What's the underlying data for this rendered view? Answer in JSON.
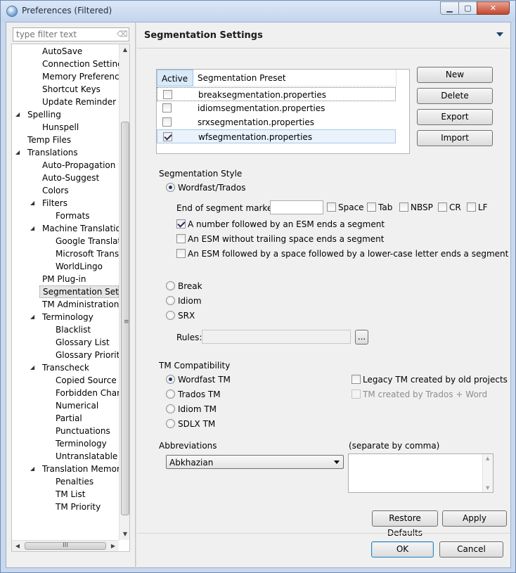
{
  "window": {
    "title": "Preferences (Filtered)",
    "controls": {
      "minimize": "▁",
      "maximize": "▢",
      "close": "✕"
    }
  },
  "filter": {
    "placeholder": "type filter text",
    "clear_icon": "⌫"
  },
  "tree": {
    "items": [
      {
        "label": "AutoSave",
        "level": 2
      },
      {
        "label": "Connection Settings",
        "level": 2
      },
      {
        "label": "Memory Preferences",
        "level": 2
      },
      {
        "label": "Shortcut Keys",
        "level": 2
      },
      {
        "label": "Update Reminder",
        "level": 2
      },
      {
        "label": "Spelling",
        "level": 1,
        "expanded": true
      },
      {
        "label": "Hunspell",
        "level": 2
      },
      {
        "label": "Temp Files",
        "level": 1
      },
      {
        "label": "Translations",
        "level": 1,
        "expanded": true
      },
      {
        "label": "Auto-Propagation",
        "level": 2
      },
      {
        "label": "Auto-Suggest",
        "level": 2
      },
      {
        "label": "Colors",
        "level": 2
      },
      {
        "label": "Filters",
        "level": 2,
        "expanded": true
      },
      {
        "label": "Formats",
        "level": 3
      },
      {
        "label": "Machine Translation",
        "level": 2,
        "expanded": true
      },
      {
        "label": "Google Translate",
        "level": 3
      },
      {
        "label": "Microsoft Translator",
        "level": 3
      },
      {
        "label": "WorldLingo",
        "level": 3
      },
      {
        "label": "PM Plug-in",
        "level": 2
      },
      {
        "label": "Segmentation Settings",
        "level": 2,
        "selected": true
      },
      {
        "label": "TM Administration",
        "level": 2
      },
      {
        "label": "Terminology",
        "level": 2,
        "expanded": true
      },
      {
        "label": "Blacklist",
        "level": 3
      },
      {
        "label": "Glossary List",
        "level": 3
      },
      {
        "label": "Glossary Priority",
        "level": 3
      },
      {
        "label": "Transcheck",
        "level": 2,
        "expanded": true
      },
      {
        "label": "Copied Source Check",
        "level": 3
      },
      {
        "label": "Forbidden Characters",
        "level": 3
      },
      {
        "label": "Numerical",
        "level": 3
      },
      {
        "label": "Partial",
        "level": 3
      },
      {
        "label": "Punctuations",
        "level": 3
      },
      {
        "label": "Terminology",
        "level": 3
      },
      {
        "label": "Untranslatable",
        "level": 3
      },
      {
        "label": "Translation Memory",
        "level": 2,
        "expanded": true
      },
      {
        "label": "Penalties",
        "level": 3
      },
      {
        "label": "TM List",
        "level": 3
      },
      {
        "label": "TM Priority",
        "level": 3
      }
    ],
    "expander_glyph": "◢",
    "scroll_up": "▲",
    "scroll_down": "▼",
    "scroll_left": "◀",
    "scroll_right": "▶",
    "vgrip": "≡",
    "hgrip": "III"
  },
  "pane": {
    "title": "Segmentation Settings",
    "table": {
      "col_active": "Active",
      "col_preset": "Segmentation Preset",
      "rows": [
        {
          "name": "breaksegmentation.properties",
          "active": false
        },
        {
          "name": "idiomsegmentation.properties",
          "active": false
        },
        {
          "name": "srxsegmentation.properties",
          "active": false
        },
        {
          "name": "wfsegmentation.properties",
          "active": true
        }
      ]
    },
    "buttons": {
      "new": "New",
      "delete": "Delete",
      "export": "Export",
      "import": "Import"
    },
    "style": {
      "heading": "Segmentation Style",
      "wordfast": "Wordfast/Trados",
      "esm_label": "End of segment markers",
      "esm_value": "",
      "space": "Space",
      "tab": "Tab",
      "nbsp": "NBSP",
      "cr": "CR",
      "lf": "LF",
      "opt1": "A number followed by an ESM ends a segment",
      "opt2": "An ESM without trailing space ends a segment",
      "opt3": "An ESM followed by a space followed by a lower-case letter ends a segment",
      "break": "Break",
      "idiom": "Idiom",
      "srx": "SRX",
      "rules_label": "Rules:",
      "rules_value": "",
      "browse": "..."
    },
    "tm": {
      "heading": "TM Compatibility",
      "wordfast": "Wordfast TM",
      "trados": "Trados TM",
      "idiom": "Idiom TM",
      "sdlx": "SDLX TM",
      "legacy": "Legacy TM created by old projects",
      "trados_word": "TM created by Trados + Word"
    },
    "abbrev": {
      "heading": "Abbreviations",
      "hint": "(separate by comma)",
      "selected": "Abkhazian",
      "text": ""
    },
    "restore": "Restore Defaults",
    "apply": "Apply"
  },
  "dialog": {
    "ok": "OK",
    "cancel": "Cancel"
  }
}
